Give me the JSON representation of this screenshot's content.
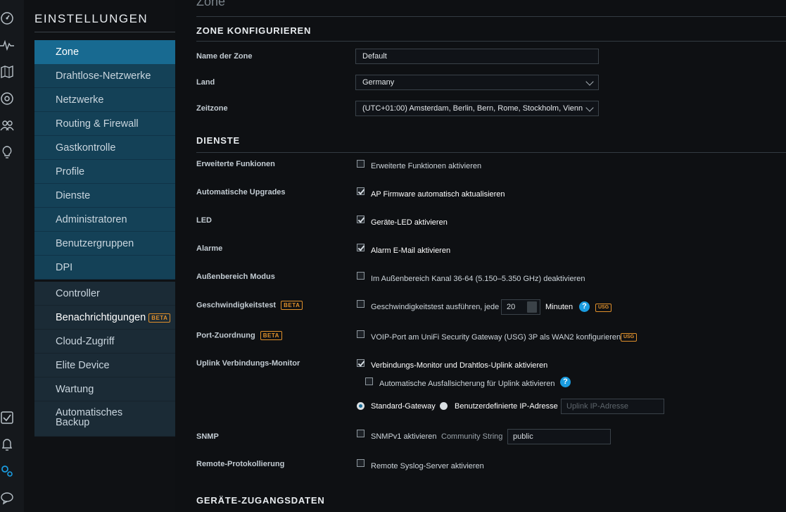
{
  "rail": {
    "icons": [
      "dashboard-icon",
      "statistics-icon",
      "map-icon",
      "devices-icon",
      "clients-icon",
      "insights-icon",
      "events-icon",
      "alerts-icon",
      "settings-icon",
      "chat-icon"
    ]
  },
  "settings": {
    "title": "EINSTELLUNGEN",
    "menu": [
      {
        "label": "Zone",
        "active": true
      },
      {
        "label": "Drahtlose-Netzwerke"
      },
      {
        "label": "Netzwerke"
      },
      {
        "label": "Routing & Firewall"
      },
      {
        "label": "Gastkontrolle"
      },
      {
        "label": "Profile"
      },
      {
        "label": "Dienste"
      },
      {
        "label": "Administratoren"
      },
      {
        "label": "Benutzergruppen"
      },
      {
        "label": "DPI"
      }
    ],
    "menu2": [
      {
        "label": "Controller"
      },
      {
        "label": "Benachrichtigungen",
        "badge": "BETA"
      },
      {
        "label": "Cloud-Zugriff"
      },
      {
        "label": "Elite Device"
      },
      {
        "label": "Wartung"
      },
      {
        "label": "Automatisches",
        "label2": "Backup"
      }
    ]
  },
  "content": {
    "page_title": "Zone",
    "zone_section": "ZONE KONFIGURIEREN",
    "zone_name_label": "Name der Zone",
    "zone_name_value": "Default",
    "country_label": "Land",
    "country_value": "Germany",
    "timezone_label": "Zeitzone",
    "timezone_value": "(UTC+01:00) Amsterdam, Berlin, Bern, Rome, Stockholm, Vienn",
    "services_section": "DIENSTE",
    "advanced_label": "Erweiterte Funkionen",
    "advanced_cb": "Erweiterte Funktionen aktivieren",
    "upgrades_label": "Automatische Upgrades",
    "upgrades_cb": "AP Firmware automatisch aktualisieren",
    "led_label": "LED",
    "led_cb": "Geräte-LED aktivieren",
    "alarms_label": "Alarme",
    "alarms_cb": "Alarm E-Mail aktivieren",
    "outdoor_label": "Außenbereich Modus",
    "outdoor_cb": "Im Außenbereich Kanal 36-64 (5.150–5.350 GHz) deaktivieren",
    "speedtest_label": "Geschwindigkeitstest",
    "speedtest_badge": "BETA",
    "speedtest_cb": "Geschwindigkeitstest ausführen, jede",
    "speedtest_value": "20",
    "speedtest_unit": "Minuten",
    "help_glyph": "?",
    "usg_badge": "USG",
    "port_label": "Port-Zuordnung",
    "port_badge": "BETA",
    "port_cb": "VOIP-Port am UniFi Security Gateway (USG) 3P als WAN2 konfigurieren",
    "uplink_label": "Uplink Verbindungs-Monitor",
    "uplink_cb": "Verbindungs-Monitor und Drahtlos-Uplink aktivieren",
    "failover_cb": "Automatische Ausfallsicherung für Uplink aktivieren",
    "radio_gateway": "Standard-Gateway",
    "radio_custom": "Benutzerdefinierte IP-Adresse",
    "uplink_ip_placeholder": "Uplink IP-Adresse",
    "snmp_label": "SNMP",
    "snmp_cb": "SNMPv1 aktivieren",
    "community_label": "Community String",
    "community_value": "public",
    "remote_label": "Remote-Protokollierung",
    "remote_cb": "Remote Syslog-Server aktivieren",
    "credentials_section": "GERÄTE-ZUGANGSDATEN"
  },
  "colors": {
    "active": "#186a91",
    "blue_item": "#144157",
    "dark_item": "#1b2b36",
    "accent": "#1a9ce0",
    "badge": "#e0902b"
  }
}
